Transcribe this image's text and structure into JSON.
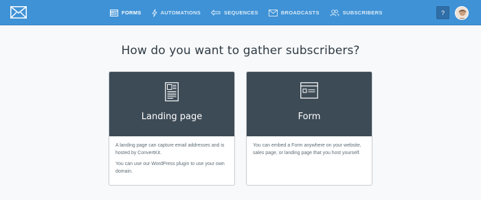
{
  "nav": {
    "items": [
      {
        "label": "FORMS",
        "icon": "form-icon"
      },
      {
        "label": "AUTOMATIONS",
        "icon": "lightning-icon"
      },
      {
        "label": "SEQUENCES",
        "icon": "sequence-icon"
      },
      {
        "label": "BROADCASTS",
        "icon": "envelope-icon"
      },
      {
        "label": "SUBSCRIBERS",
        "icon": "users-icon"
      }
    ],
    "active": "FORMS"
  },
  "header": {
    "help_label": "?"
  },
  "main": {
    "heading": "How do you want to gather subscribers?",
    "cards": [
      {
        "title": "Landing page",
        "icon": "landing-page-icon",
        "paragraphs": [
          "A landing page can capture email addresses and is hosted by ConvertKit.",
          "You can use our WordPress plugin to use your own domain."
        ]
      },
      {
        "title": "Form",
        "icon": "form-window-icon",
        "paragraphs": [
          "You can embed a Form anywhere on your website, sales page, or landing page that you host yourself."
        ]
      }
    ]
  },
  "colors": {
    "topbar": "#3f92d6",
    "card_header": "#3d4b56",
    "background": "#f8f9fa"
  }
}
